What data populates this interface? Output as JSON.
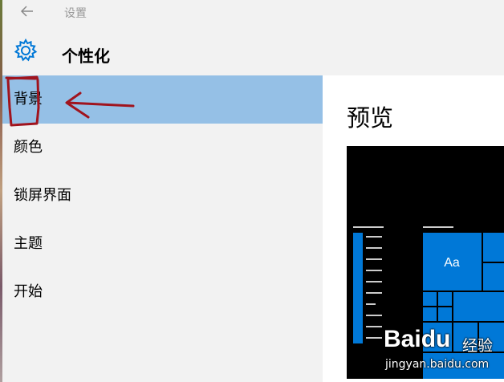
{
  "window": {
    "app_title": "设置"
  },
  "header": {
    "title": "个性化"
  },
  "sidebar": {
    "items": [
      {
        "label": "背景"
      },
      {
        "label": "颜色"
      },
      {
        "label": "锁屏界面"
      },
      {
        "label": "主题"
      },
      {
        "label": "开始"
      }
    ],
    "selected_index": 0
  },
  "main": {
    "preview_heading": "预览",
    "tile_label": "Aa"
  },
  "watermark": {
    "logo_bai": "Bai",
    "logo_du": "du",
    "suffix": "经验",
    "url": "jingyan.baidu.com"
  },
  "colors": {
    "accent": "#0078d7",
    "selected_bg": "#95c0e6",
    "annotation": "#a0141e"
  },
  "icons": {
    "back": "back-arrow-icon",
    "settings": "gear-icon"
  }
}
